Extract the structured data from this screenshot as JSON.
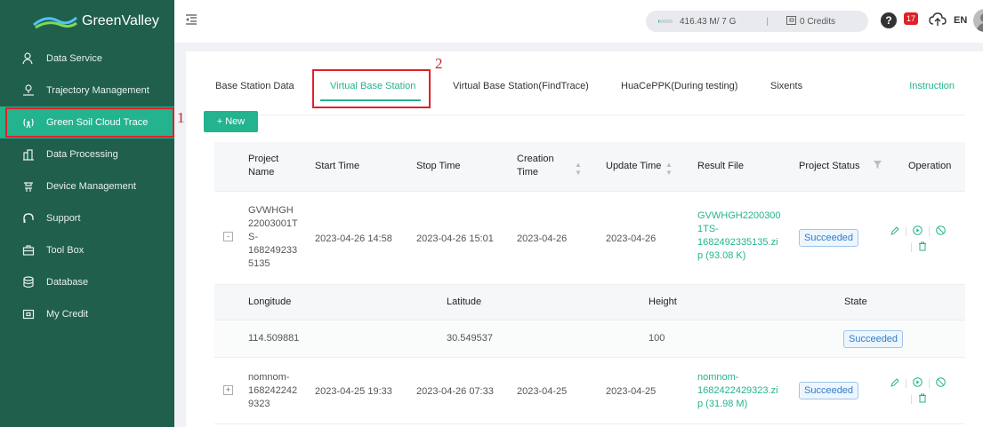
{
  "app": {
    "brand": "GreenValley"
  },
  "sidebar": {
    "items": [
      {
        "label": "Data Service",
        "icon": "user-data-icon"
      },
      {
        "label": "Trajectory Management",
        "icon": "person-pin-icon"
      },
      {
        "label": "Green Soil Cloud Trace",
        "icon": "signal-tower-icon",
        "active": true
      },
      {
        "label": "Data Processing",
        "icon": "building-icon"
      },
      {
        "label": "Device Management",
        "icon": "device-icon"
      },
      {
        "label": "Support",
        "icon": "headset-icon"
      },
      {
        "label": "Tool Box",
        "icon": "toolbox-icon"
      },
      {
        "label": "Database",
        "icon": "database-icon"
      },
      {
        "label": "My Credit",
        "icon": "credit-card-icon"
      }
    ]
  },
  "header": {
    "storage": "416.43 M/ 7 G",
    "storage_fraction": 0.06,
    "credits": "0 Credits",
    "notifications": "17",
    "language": "EN"
  },
  "annotations": {
    "mark1": "1",
    "mark2": "2"
  },
  "tabs": [
    {
      "label": "Base Station Data"
    },
    {
      "label": "Virtual Base Station",
      "active": true
    },
    {
      "label": "Virtual Base Station(FindTrace)"
    },
    {
      "label": "HuaCePPK(During testing)"
    },
    {
      "label": "Sixents"
    }
  ],
  "instruction_label": "Instruction",
  "new_button": "+ New",
  "table": {
    "headers": {
      "project_name": "Project Name",
      "start_time": "Start Time",
      "stop_time": "Stop Time",
      "creation_time": "Creation Time",
      "update_time": "Update Time",
      "result_file": "Result File",
      "project_status": "Project Status",
      "operation": "Operation"
    },
    "rows": [
      {
        "expand": "-",
        "project_name": "GVWHGH 22003001T S- 168249233 5135",
        "start_time": "2023-04-26 14:58",
        "stop_time": "2023-04-26 15:01",
        "creation_time": "2023-04-26",
        "update_time": "2023-04-26",
        "result_file": "GVWHGH2200300 1TS- 1682492335135.zi p (93.08 K)",
        "status": "Succeeded"
      },
      {
        "expand": "+",
        "project_name": "nomnom- 168242242 9323",
        "start_time": "2023-04-25 19:33",
        "stop_time": "2023-04-26 07:33",
        "creation_time": "2023-04-25",
        "update_time": "2023-04-25",
        "result_file": "nomnom- 1682422429323.zi p (31.98 M)",
        "status": "Succeeded"
      }
    ],
    "subtable": {
      "headers": {
        "longitude": "Longitude",
        "latitude": "Latitude",
        "height": "Height",
        "state": "State"
      },
      "row": {
        "longitude": "114.509881",
        "latitude": "30.549537",
        "height": "100",
        "state": "Succeeded"
      }
    }
  },
  "colors": {
    "sidebar": "#1f5f4c",
    "accent": "#23b38e",
    "highlight": "#e0202a"
  }
}
